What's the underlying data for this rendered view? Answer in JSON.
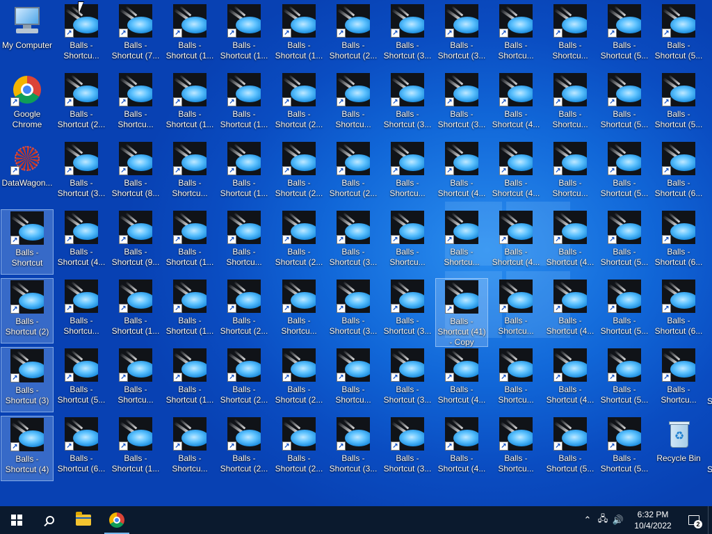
{
  "desktop": {
    "special_icons": [
      {
        "id": "pc",
        "label": "My Computer",
        "icon": "computer-icon",
        "col": 0,
        "row": 0
      },
      {
        "id": "chrome",
        "label": "Google\nChrome",
        "icon": "chrome-icon",
        "col": 0,
        "row": 1,
        "shortcut": true
      },
      {
        "id": "datawagon",
        "label": "DataWagon...",
        "icon": "datawagon-icon",
        "col": 0,
        "row": 2,
        "shortcut": true
      },
      {
        "id": "recycle",
        "label": "Recycle Bin",
        "icon": "recycle-bin-icon",
        "col": 12,
        "row": 6
      }
    ],
    "balls_icons": [
      {
        "label": "Balls -\nShortcu...",
        "col": 1,
        "row": 0
      },
      {
        "label": "Balls -\nShortcut (7...",
        "col": 2,
        "row": 0
      },
      {
        "label": "Balls -\nShortcut (1...",
        "col": 3,
        "row": 0
      },
      {
        "label": "Balls -\nShortcut (1...",
        "col": 4,
        "row": 0
      },
      {
        "label": "Balls -\nShortcut (1...",
        "col": 5,
        "row": 0
      },
      {
        "label": "Balls -\nShortcut (2...",
        "col": 6,
        "row": 0
      },
      {
        "label": "Balls -\nShortcut (3...",
        "col": 7,
        "row": 0
      },
      {
        "label": "Balls -\nShortcut (3...",
        "col": 8,
        "row": 0
      },
      {
        "label": "Balls -\nShortcu...",
        "col": 9,
        "row": 0
      },
      {
        "label": "Balls -\nShortcu...",
        "col": 10,
        "row": 0
      },
      {
        "label": "Balls -\nShortcut (5...",
        "col": 11,
        "row": 0
      },
      {
        "label": "Balls -\nShortcut (5...",
        "col": 12,
        "row": 0
      },
      {
        "label": "Balls -\nShortcut (2...",
        "col": 1,
        "row": 1
      },
      {
        "label": "Balls -\nShortcu...",
        "col": 2,
        "row": 1
      },
      {
        "label": "Balls -\nShortcut (1...",
        "col": 3,
        "row": 1
      },
      {
        "label": "Balls -\nShortcut (1...",
        "col": 4,
        "row": 1
      },
      {
        "label": "Balls -\nShortcut (2...",
        "col": 5,
        "row": 1
      },
      {
        "label": "Balls -\nShortcu...",
        "col": 6,
        "row": 1
      },
      {
        "label": "Balls -\nShortcut (3...",
        "col": 7,
        "row": 1
      },
      {
        "label": "Balls -\nShortcut (3...",
        "col": 8,
        "row": 1
      },
      {
        "label": "Balls -\nShortcut (4...",
        "col": 9,
        "row": 1
      },
      {
        "label": "Balls -\nShortcu...",
        "col": 10,
        "row": 1
      },
      {
        "label": "Balls -\nShortcut (5...",
        "col": 11,
        "row": 1
      },
      {
        "label": "Balls -\nShortcut (5...",
        "col": 12,
        "row": 1
      },
      {
        "label": "Balls -\nShortcut (3...",
        "col": 1,
        "row": 2
      },
      {
        "label": "Balls -\nShortcut (8...",
        "col": 2,
        "row": 2
      },
      {
        "label": "Balls -\nShortcu...",
        "col": 3,
        "row": 2
      },
      {
        "label": "Balls -\nShortcut (1...",
        "col": 4,
        "row": 2
      },
      {
        "label": "Balls -\nShortcut (2...",
        "col": 5,
        "row": 2
      },
      {
        "label": "Balls -\nShortcut (2...",
        "col": 6,
        "row": 2
      },
      {
        "label": "Balls -\nShortcu...",
        "col": 7,
        "row": 2
      },
      {
        "label": "Balls -\nShortcut (4...",
        "col": 8,
        "row": 2
      },
      {
        "label": "Balls -\nShortcut (4...",
        "col": 9,
        "row": 2
      },
      {
        "label": "Balls -\nShortcu...",
        "col": 10,
        "row": 2
      },
      {
        "label": "Balls -\nShortcut (5...",
        "col": 11,
        "row": 2
      },
      {
        "label": "Balls -\nShortcut (6...",
        "col": 12,
        "row": 2
      },
      {
        "label": "Balls -\nShortcut",
        "col": 0,
        "row": 3,
        "selected": true
      },
      {
        "label": "Balls -\nShortcut (4...",
        "col": 1,
        "row": 3
      },
      {
        "label": "Balls -\nShortcut (9...",
        "col": 2,
        "row": 3
      },
      {
        "label": "Balls -\nShortcut (1...",
        "col": 3,
        "row": 3
      },
      {
        "label": "Balls -\nShortcu...",
        "col": 4,
        "row": 3
      },
      {
        "label": "Balls -\nShortcut (2...",
        "col": 5,
        "row": 3
      },
      {
        "label": "Balls -\nShortcut (3...",
        "col": 6,
        "row": 3
      },
      {
        "label": "Balls -\nShortcu...",
        "col": 7,
        "row": 3
      },
      {
        "label": "Balls -\nShortcu...",
        "col": 8,
        "row": 3
      },
      {
        "label": "Balls -\nShortcut (4...",
        "col": 9,
        "row": 3
      },
      {
        "label": "Balls -\nShortcut (4...",
        "col": 10,
        "row": 3
      },
      {
        "label": "Balls -\nShortcut (5...",
        "col": 11,
        "row": 3
      },
      {
        "label": "Balls -\nShortcut (6...",
        "col": 12,
        "row": 3
      },
      {
        "label": "Balls -\nShortcut (2)",
        "col": 0,
        "row": 4,
        "selected": true
      },
      {
        "label": "Balls -\nShortcu...",
        "col": 1,
        "row": 4
      },
      {
        "label": "Balls -\nShortcut (1...",
        "col": 2,
        "row": 4
      },
      {
        "label": "Balls -\nShortcut (1...",
        "col": 3,
        "row": 4
      },
      {
        "label": "Balls -\nShortcut (2...",
        "col": 4,
        "row": 4
      },
      {
        "label": "Balls -\nShortcu...",
        "col": 5,
        "row": 4
      },
      {
        "label": "Balls -\nShortcut (3...",
        "col": 6,
        "row": 4
      },
      {
        "label": "Balls -\nShortcut (3...",
        "col": 7,
        "row": 4
      },
      {
        "label": "Balls -\nShortcut (41)\n- Copy",
        "col": 8,
        "row": 4,
        "selected": true,
        "tall": true
      },
      {
        "label": "Balls -\nShortcu...",
        "col": 9,
        "row": 4
      },
      {
        "label": "Balls -\nShortcut (4...",
        "col": 10,
        "row": 4
      },
      {
        "label": "Balls -\nShortcut (5...",
        "col": 11,
        "row": 4
      },
      {
        "label": "Balls -\nShortcut (6...",
        "col": 12,
        "row": 4
      },
      {
        "label": "Balls -\nShortcut (3)",
        "col": 0,
        "row": 5,
        "selected": true
      },
      {
        "label": "Balls -\nShortcut (5...",
        "col": 1,
        "row": 5
      },
      {
        "label": "Balls -\nShortcu...",
        "col": 2,
        "row": 5
      },
      {
        "label": "Balls -\nShortcut (1...",
        "col": 3,
        "row": 5
      },
      {
        "label": "Balls -\nShortcut (2...",
        "col": 4,
        "row": 5
      },
      {
        "label": "Balls -\nShortcut (2...",
        "col": 5,
        "row": 5
      },
      {
        "label": "Balls -\nShortcu...",
        "col": 6,
        "row": 5
      },
      {
        "label": "Balls -\nShortcut (3...",
        "col": 7,
        "row": 5
      },
      {
        "label": "Balls -\nShortcut (4...",
        "col": 8,
        "row": 5
      },
      {
        "label": "Balls -\nShortcu...",
        "col": 9,
        "row": 5
      },
      {
        "label": "Balls -\nShortcut (4...",
        "col": 10,
        "row": 5
      },
      {
        "label": "Balls -\nShortcut (5...",
        "col": 11,
        "row": 5
      },
      {
        "label": "Balls -\nShortcu...",
        "col": 12,
        "row": 5
      },
      {
        "label": "Balls -\nShortcut (4)",
        "col": 0,
        "row": 6,
        "selected": true
      },
      {
        "label": "Balls -\nShortcut (6...",
        "col": 1,
        "row": 6
      },
      {
        "label": "Balls -\nShortcut (1...",
        "col": 2,
        "row": 6
      },
      {
        "label": "Balls -\nShortcu...",
        "col": 3,
        "row": 6
      },
      {
        "label": "Balls -\nShortcut (2...",
        "col": 4,
        "row": 6
      },
      {
        "label": "Balls -\nShortcut (2...",
        "col": 5,
        "row": 6
      },
      {
        "label": "Balls -\nShortcut (3...",
        "col": 6,
        "row": 6
      },
      {
        "label": "Balls -\nShortcut (3...",
        "col": 7,
        "row": 6
      },
      {
        "label": "Balls -\nShortcut (4...",
        "col": 8,
        "row": 6
      },
      {
        "label": "Balls -\nShortcu...",
        "col": 9,
        "row": 6
      },
      {
        "label": "Balls -\nShortcut (5...",
        "col": 10,
        "row": 6
      },
      {
        "label": "Balls -\nShortcut (5...",
        "col": 11,
        "row": 6
      }
    ],
    "edge_fragments": [
      "S",
      "S"
    ]
  },
  "taskbar": {
    "buttons": [
      {
        "name": "start-button",
        "icon": "windows-logo-icon"
      },
      {
        "name": "search-button",
        "icon": "search-icon"
      },
      {
        "name": "file-explorer-button",
        "icon": "folder-icon"
      },
      {
        "name": "chrome-taskbar-button",
        "icon": "chrome-icon",
        "active": true
      }
    ],
    "tray": {
      "icons": [
        "chevron-up-icon",
        "network-icon",
        "volume-icon"
      ],
      "time": "6:32 PM",
      "date": "10/4/2022",
      "notification_count": "2"
    }
  }
}
